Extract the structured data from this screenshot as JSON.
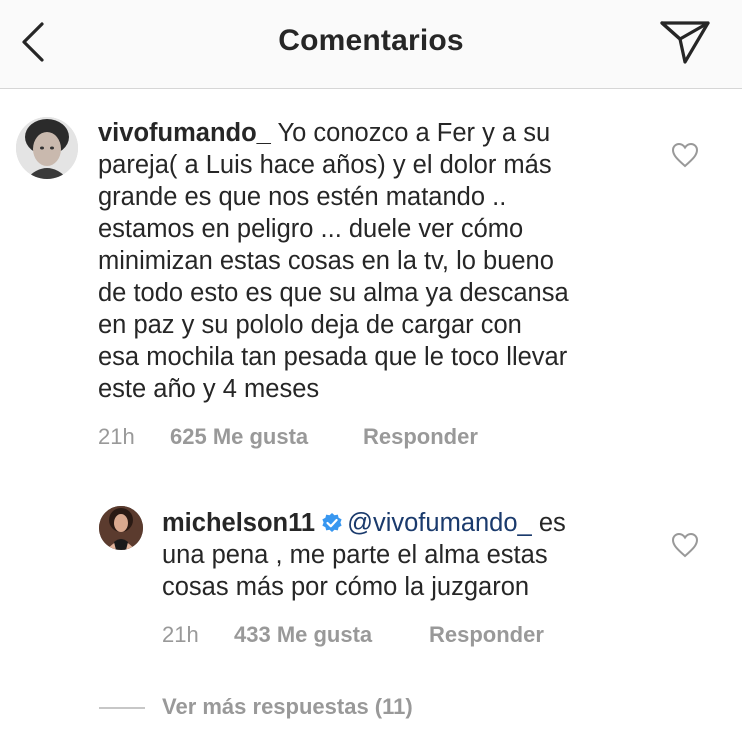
{
  "header": {
    "title": "Comentarios",
    "back_icon": "chevron-left-icon",
    "send_icon": "paper-plane-icon"
  },
  "comments": [
    {
      "username": "vivofumando_",
      "text": "Yo conozco a Fer y a su\npareja( a Luis hace años) y el dolor más\ngrande es que nos estén matando ..\nestamos en peligro ... duele ver cómo\nminimizan estas cosas en la tv, lo bueno\nde todo esto es que su alma ya descansa\nen paz y su pololo deja de cargar con\nesa mochila tan pesada que le toco llevar\neste año y 4 meses",
      "time": "21h",
      "likes": "625 Me gusta",
      "reply_label": "Responder"
    }
  ],
  "reply": {
    "username": "michelson11",
    "verified": true,
    "mention": "@vivofumando_",
    "text": " es\nuna pena , me parte el alma estas\ncosas más por cómo la juzgaron",
    "time": "21h",
    "likes": "433 Me gusta",
    "reply_label": "Responder"
  },
  "more_replies": "Ver más respuestas (11)",
  "colors": {
    "verified_badge": "#3897f0",
    "mention": "#1a3a6c",
    "meta_text": "#999999"
  }
}
